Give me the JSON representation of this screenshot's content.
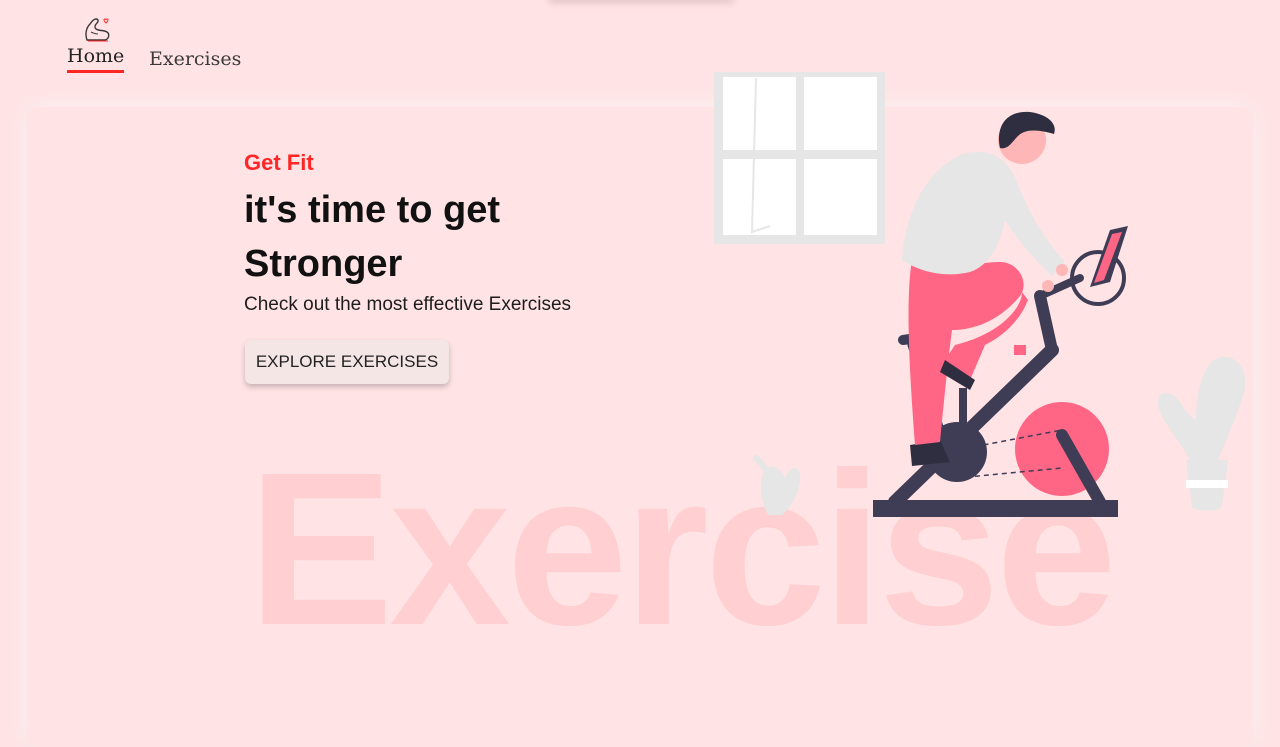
{
  "nav": {
    "home_label": "Home",
    "exercises_label": "Exercises"
  },
  "hero": {
    "kicker": "Get Fit",
    "headline_line1": "it's time to get",
    "headline_line2": "Stronger",
    "subtitle": "Check out the most effective Exercises",
    "cta_label": "EXPLORE EXERCISES",
    "watermark": "Exercise"
  },
  "colors": {
    "accent": "#ff2625",
    "background": "#ffe3e5",
    "pink": "#ff6584",
    "dark": "#3f3d56"
  }
}
